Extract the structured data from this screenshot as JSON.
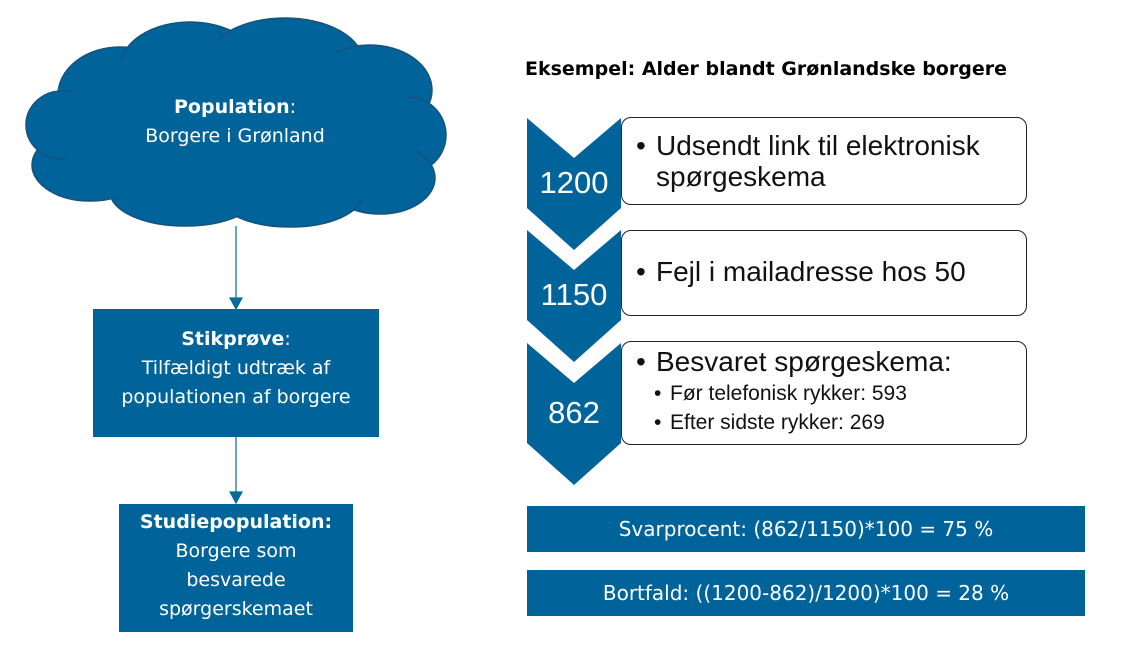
{
  "population": {
    "title": "Population",
    "text": "Borgere i Grønland"
  },
  "sample": {
    "title": "Stikprøve",
    "line1": "Tilfældigt udtræk af",
    "line2": "populationen af borgere"
  },
  "study": {
    "title": "Studiepopulation:",
    "line1": "Borgere som",
    "line2": "besvarede",
    "line3": "spørgerskemaet"
  },
  "example_heading": "Eksempel: Alder blandt Grønlandske borgere",
  "steps": [
    {
      "number": "1200",
      "text": "Udsendt link til elektronisk spørgeskema"
    },
    {
      "number": "1150",
      "text": "Fejl i mailadresse hos 50"
    },
    {
      "number": "862",
      "text": "Besvaret spørgeskema:",
      "sub1": "Før telefonisk rykker: 593",
      "sub2": "Efter sidste rykker: 269"
    }
  ],
  "response_rate": "Svarprocent: (862/1150)*100 = 75 %",
  "dropout": "Bortfald: ((1200-862)/1200)*100 = 28 %",
  "colors": {
    "primary": "#00649b",
    "border": "#222222"
  }
}
